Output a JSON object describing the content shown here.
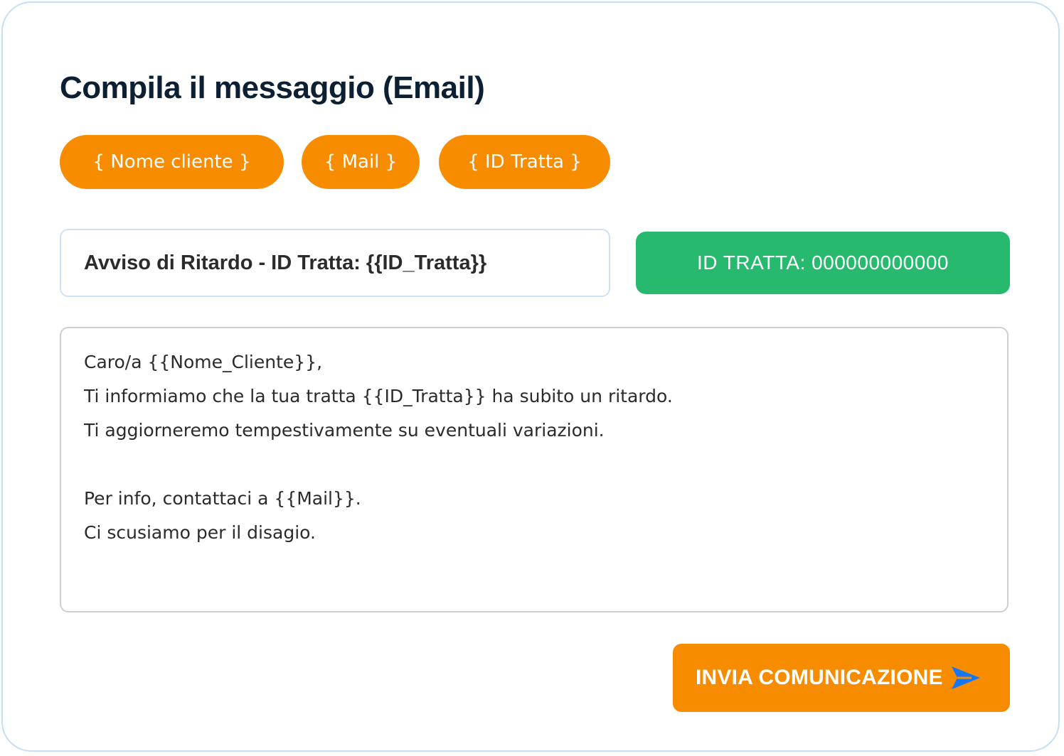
{
  "title": "Compila il messaggio (Email)",
  "placeholders": [
    {
      "label": "{ Nome cliente }"
    },
    {
      "label": "{ Mail }"
    },
    {
      "label": "{ ID Tratta }"
    }
  ],
  "subject": {
    "value": "Avviso di Ritardo - ID Tratta: {{ID_Tratta}}"
  },
  "id_badge": {
    "text": "ID TRATTA: 000000000000"
  },
  "message": {
    "lines": [
      "Caro/a {{Nome_Cliente}},",
      "Ti informiamo che la tua tratta {{ID_Tratta}} ha subito un ritardo.",
      "Ti aggiorneremo tempestivamente su eventuali variazioni.",
      "",
      "Per info, contattaci a {{Mail}}.",
      "Ci scusiamo per il disagio."
    ]
  },
  "send_button": {
    "label": "INVIA COMUNICAZIONE",
    "icon": "send-icon"
  },
  "colors": {
    "accent_orange": "#f88c00",
    "badge_green": "#27ba6f",
    "title_navy": "#0d2033",
    "card_border": "#c6def6",
    "send_icon_blue": "#1677f2"
  }
}
